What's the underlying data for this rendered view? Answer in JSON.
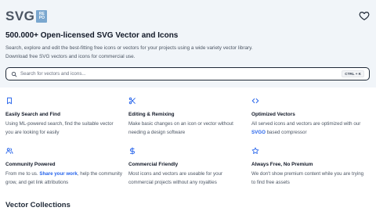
{
  "header": {
    "logo_text": "SVG",
    "logo_badge_line1": "RE",
    "logo_badge_line2": "PO",
    "favorites_icon": "heart-icon"
  },
  "hero": {
    "headline": "500.000+ Open-licensed SVG Vector and Icons",
    "subtext_line1": "Search, explore and edit the best-fitting free icons or vectors for your projects using a wide variety vector library.",
    "subtext_line2": "Download free SVG vectors and icons for commercial use."
  },
  "search": {
    "placeholder": "Search for vectors and icons...",
    "shortcut": "CTRL + K",
    "icon": "search-icon"
  },
  "features": [
    {
      "icon": "bookmark-icon",
      "title": "Easily Search and Find",
      "desc_line1": "Using ML-powered search, find the suitable vector",
      "desc_line2": "you are looking for easily"
    },
    {
      "icon": "scissors-icon",
      "title": "Editing & Remixing",
      "desc_line1": "Make basic changes on an icon or vector without",
      "desc_line2": "needing a design software"
    },
    {
      "icon": "code-icon",
      "title": "Optimized Vectors",
      "desc_line1": "All served icons and vectors are optimized with our",
      "desc_link": "SVGO",
      "desc_line2_rest": " based compressor"
    },
    {
      "icon": "users-icon",
      "title": "Community Powered",
      "desc_pre": "From me to us. ",
      "desc_link": "Share your work",
      "desc_line1_rest": ", help the community",
      "desc_line2": "grow, and get link attributions"
    },
    {
      "icon": "dollar-icon",
      "title": "Commercial Friendly",
      "desc_line1": "Most icons and vectors are useable for your",
      "desc_line2": "commercial projects without any royalties"
    },
    {
      "icon": "star-icon",
      "title": "Always Free, No Premium",
      "desc_line1": "We don't show premium content while you are trying",
      "desc_line2": "to find free assets"
    }
  ],
  "collections": {
    "heading": "Vector Collections"
  },
  "colors": {
    "hero_background": "#f1f5f9",
    "icon_accent": "#2563eb",
    "link": "#2563eb",
    "logo_badge": "#7aa7cf"
  }
}
